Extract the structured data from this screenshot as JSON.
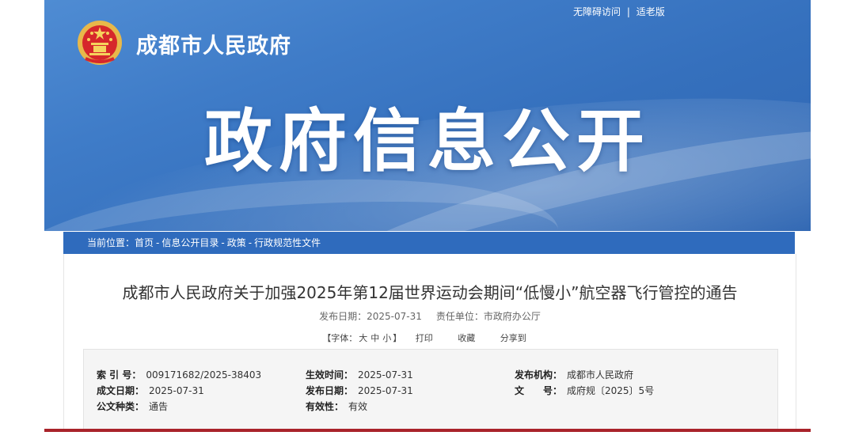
{
  "header": {
    "top_links": {
      "accessible": "无障碍访问",
      "separator": "|",
      "elder": "适老版"
    },
    "site_title": "成都市人民政府",
    "banner_title": "政府信息公开"
  },
  "breadcrumb": {
    "prefix": "当前位置：",
    "items": [
      "首页",
      "信息公开目录",
      "政策",
      "行政规范性文件"
    ],
    "separator": "-"
  },
  "article": {
    "title": "成都市人民政府关于加强2025年第12届世界运动会期间“低慢小”航空器飞行管控的通告",
    "publish_date_label": "发布日期：",
    "publish_date": "2025-07-31",
    "unit_label": "责任单位：",
    "unit": "市政府办公厅"
  },
  "tools": {
    "font_label_open": "【字体：",
    "sizes": [
      "大",
      "中",
      "小"
    ],
    "font_label_close": "】",
    "print": "打印",
    "favorite": "收藏",
    "share": "分享到"
  },
  "info": {
    "index_label": "索 引 号：",
    "index": "009171682/2025-38403",
    "effective_time_label": "生效时间：",
    "effective_time": "2025-07-31",
    "issuer_label": "发布机构：",
    "issuer": "成都市人民政府",
    "written_date_label": "成文日期：",
    "written_date": "2025-07-31",
    "publish_date_label": "发布日期：",
    "publish_date": "2025-07-31",
    "doc_no_label": "文　　号：",
    "doc_no": "成府规〔2025〕5号",
    "doc_type_label": "公文种类：",
    "doc_type": "通告",
    "validity_label": "有效性：",
    "validity": "有效"
  },
  "colors": {
    "banner_blue": "#3a77c4",
    "breadcrumb_blue": "#2f6bbd",
    "accent_red": "#a9232a",
    "emblem_gold": "#e8b84a"
  }
}
